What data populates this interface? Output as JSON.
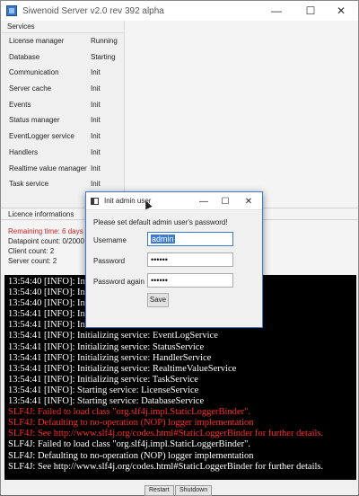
{
  "window": {
    "title": "Siwenoid Server v2.0 rev 392 alpha",
    "min": "—",
    "max": "☐",
    "close": "✕"
  },
  "services": {
    "header": "Services",
    "items": [
      {
        "name": "License manager",
        "state": "Running"
      },
      {
        "name": "Database",
        "state": "Starting"
      },
      {
        "name": "Communication",
        "state": "Init"
      },
      {
        "name": "Server cache",
        "state": "Init"
      },
      {
        "name": "Events",
        "state": "Init"
      },
      {
        "name": "Status manager",
        "state": "Init"
      },
      {
        "name": "EventLogger service",
        "state": "Init"
      },
      {
        "name": "Handlers",
        "state": "Init"
      },
      {
        "name": "Realtime value manager",
        "state": "Init"
      },
      {
        "name": "Task service",
        "state": "Init"
      }
    ]
  },
  "licence": {
    "header": "Licence informations",
    "remaining": "Remaining time: 6 days 2",
    "datapoints": "Datapoint count: 0/2000",
    "clients": "Client count: 2",
    "servers": "Server count: 2"
  },
  "console": {
    "lines": [
      {
        "text": "13:54:40 [INFO]: In",
        "type": "info"
      },
      {
        "text": "13:54:40 [INFO]: In",
        "type": "info"
      },
      {
        "text": "13:54:40 [INFO]: In",
        "type": "info"
      },
      {
        "text": "13:54:41 [INFO]: In",
        "type": "info"
      },
      {
        "text": "13:54:41 [INFO]: In",
        "type": "info"
      },
      {
        "text": "13:54:41 [INFO]: Initializing service: EventLogService",
        "type": "info"
      },
      {
        "text": "13:54:41 [INFO]: Initializing service: StatusService",
        "type": "info"
      },
      {
        "text": "13:54:41 [INFO]: Initializing service: HandlerService",
        "type": "info"
      },
      {
        "text": "13:54:41 [INFO]: Initializing service: RealtimeValueService",
        "type": "info"
      },
      {
        "text": "13:54:41 [INFO]: Initializing service: TaskService",
        "type": "info"
      },
      {
        "text": "13:54:41 [INFO]: Starting service: LicenseService",
        "type": "info"
      },
      {
        "text": "13:54:41 [INFO]: Starting service: DatabaseService",
        "type": "info"
      },
      {
        "text": "SLF4J: Failed to load class \"org.slf4j.impl.StaticLoggerBinder\".",
        "type": "error"
      },
      {
        "text": "SLF4J: Defaulting to no-operation (NOP) logger implementation",
        "type": "error"
      },
      {
        "text": "SLF4J: See http://www.slf4j.org/codes.html#StaticLoggerBinder for further details.",
        "type": "error"
      },
      {
        "text": "SLF4J: Failed to load class \"org.slf4j.impl.StaticLoggerBinder\".",
        "type": "info"
      },
      {
        "text": "SLF4J: Defaulting to no-operation (NOP) logger implementation",
        "type": "info"
      },
      {
        "text": "SLF4J: See http://www.slf4j.org/codes.html#StaticLoggerBinder for further details.",
        "type": "info"
      }
    ]
  },
  "bottom": {
    "btn1": "Restart",
    "btn2": "Shutdown"
  },
  "dialog": {
    "title": "Init admin user",
    "min": "—",
    "max": "☐",
    "close": "✕",
    "prompt": "Please set default admin user's password!",
    "username_label": "Username",
    "username_value": "admin",
    "password_label": "Password",
    "password_value": "••••••",
    "password_again_label": "Password again",
    "password_again_value": "••••••",
    "save_label": "Save"
  },
  "colors": {
    "error": "#ff2a2a",
    "accent": "#3d7bd1",
    "licence_warning": "#d12424"
  }
}
